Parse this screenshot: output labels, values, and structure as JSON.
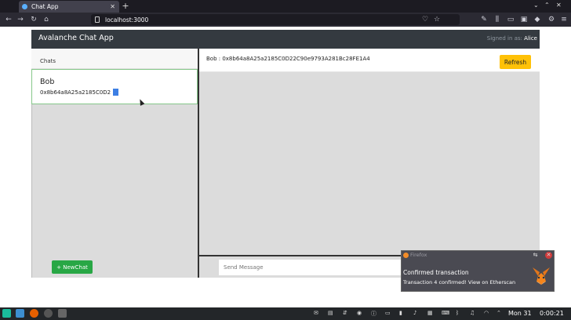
{
  "browser": {
    "tab_title": "Chat App",
    "url": "localhost:3000",
    "new_tab_icon": "plus-icon"
  },
  "app": {
    "brand": "Avalanche Chat App",
    "signed_in_label": "Signed in as:",
    "signed_in_user": "Alice",
    "chats_header": "Chats",
    "chats": [
      {
        "name": "Bob",
        "address": "0x8b64a8A25a2185C0D2"
      }
    ],
    "new_chat_label": "+ NewChat",
    "conversation_title": "Bob : 0x8b64a8A25a2185C0D22C90e9793A281Bc28FE1A4",
    "refresh_label": "Refresh",
    "message_placeholder": "Send Message"
  },
  "notification": {
    "app_name": "Firefox",
    "title": "Confirmed transaction",
    "body": "Transaction 4 confirmed! View on Etherscan"
  },
  "taskbar": {
    "day": "Mon 31",
    "time": "0:00:21"
  },
  "colors": {
    "appbar": "#343a40",
    "refresh": "#ffc107",
    "new_chat": "#28a745",
    "chat_border": "#86c78a"
  }
}
